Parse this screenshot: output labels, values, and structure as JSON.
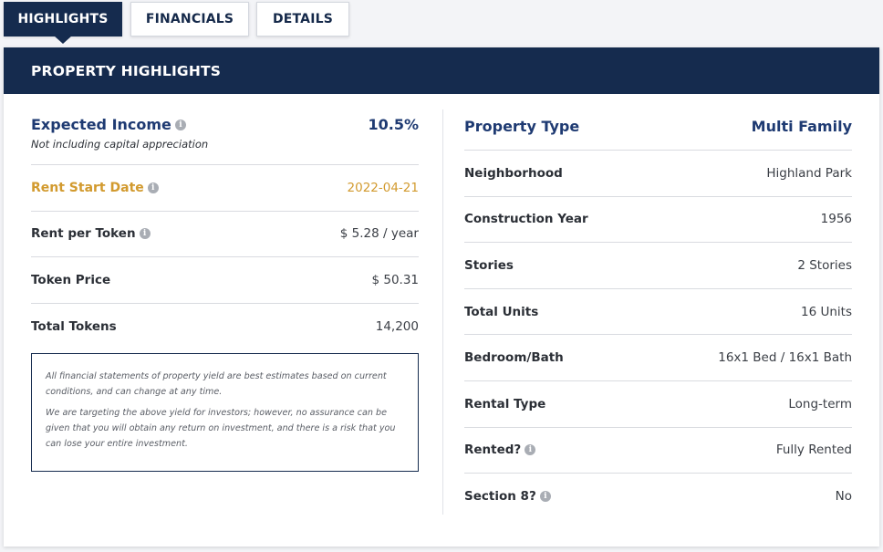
{
  "tabs": [
    {
      "label": "HIGHLIGHTS",
      "active": true
    },
    {
      "label": "FINANCIALS",
      "active": false
    },
    {
      "label": "DETAILS",
      "active": false
    }
  ],
  "panel": {
    "title": "PROPERTY HIGHLIGHTS"
  },
  "left": {
    "expected_income": {
      "label": "Expected Income",
      "value": "10.5%",
      "note": "Not including capital appreciation"
    },
    "rows": [
      {
        "label": "Rent Start Date",
        "value": "2022-04-21",
        "info": true
      },
      {
        "label": "Rent per Token",
        "value": "$ 5.28 / year",
        "info": true
      },
      {
        "label": "Token Price",
        "value": "$ 50.31",
        "info": false
      },
      {
        "label": "Total Tokens",
        "value": "14,200",
        "info": false
      }
    ],
    "disclaimer": [
      "All financial statements of property yield are best estimates based on current conditions, and can change at any time.",
      "We are targeting the above yield for investors; however, no assurance can be given that you will obtain any return on investment, and there is a risk that you can lose your entire investment."
    ]
  },
  "right": {
    "rows": [
      {
        "label": "Property Type",
        "value": "Multi Family"
      },
      {
        "label": "Neighborhood",
        "value": "Highland Park"
      },
      {
        "label": "Construction Year",
        "value": "1956"
      },
      {
        "label": "Stories",
        "value": "2 Stories"
      },
      {
        "label": "Total Units",
        "value": "16 Units"
      },
      {
        "label": "Bedroom/Bath",
        "value": "16x1 Bed / 16x1 Bath"
      },
      {
        "label": "Rental Type",
        "value": "Long-term"
      },
      {
        "label": "Rented?",
        "value": "Fully Rented"
      },
      {
        "label": "Section 8?",
        "value": "No"
      }
    ]
  },
  "colors": {
    "navy": "#152b4e",
    "accent_blue": "#1e3a72",
    "gold": "#d29a2e"
  },
  "icons": {
    "info": "info-circle-icon"
  }
}
